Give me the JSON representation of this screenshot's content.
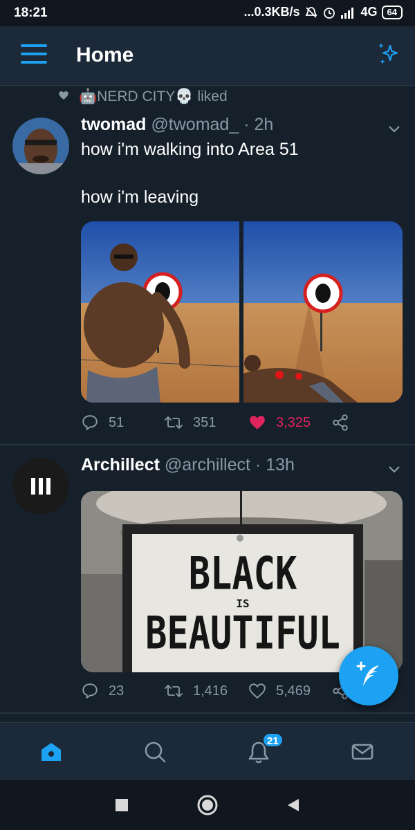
{
  "status_bar": {
    "time": "18:21",
    "network_speed": "...0.3KB/s",
    "network_type": "4G",
    "battery": "64",
    "icons": [
      "mute-icon",
      "alarm-icon",
      "signal-icon"
    ]
  },
  "header": {
    "title": "Home",
    "menu_icon": "hamburger-icon",
    "sparkle_icon": "sparkle-icon"
  },
  "tweets": [
    {
      "social_context": {
        "user": "🤖NERD CITY💀",
        "action": "liked"
      },
      "name": "twomad",
      "handle": "@twomad_",
      "time": "· 2h",
      "text_line1": "how i'm walking into Area 51",
      "text_line2": "how i'm leaving",
      "replies": "51",
      "retweets": "351",
      "likes": "3,325",
      "liked": true
    },
    {
      "name": "Archillect",
      "handle": "@archillect",
      "time": "· 13h",
      "sign_line1": "BLACK",
      "sign_line2": "IS",
      "sign_line3": "BEAUTIFUL",
      "replies": "23",
      "retweets": "1,416",
      "likes": "5,469",
      "liked": false
    }
  ],
  "bottom_nav": {
    "items": [
      "home-icon",
      "search-icon",
      "notifications-icon",
      "messages-icon"
    ],
    "notifications_badge": "21"
  },
  "colors": {
    "background": "#15202b",
    "header": "#1c2938",
    "accent": "#1da1f2",
    "like": "#e0245e",
    "muted": "#8899a6"
  }
}
